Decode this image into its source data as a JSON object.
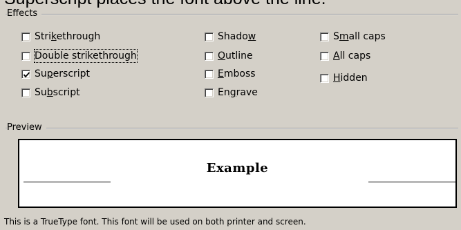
{
  "tooltip_caption": "Superscript places the font above the line.",
  "effects": {
    "group_title": "Effects",
    "options": [
      {
        "pre": "Stri",
        "key": "k",
        "post": "ethrough",
        "checked": false,
        "focused": false
      },
      {
        "pre": "Double strikethrough",
        "key": "",
        "post": "",
        "checked": false,
        "focused": true
      },
      {
        "pre": "Su",
        "key": "p",
        "post": "erscript",
        "checked": true,
        "focused": false
      },
      {
        "pre": "Su",
        "key": "b",
        "post": "script",
        "checked": false,
        "focused": false
      },
      {
        "pre": "Shado",
        "key": "w",
        "post": "",
        "checked": false,
        "focused": false
      },
      {
        "pre": "",
        "key": "O",
        "post": "utline",
        "checked": false,
        "focused": false
      },
      {
        "pre": "",
        "key": "E",
        "post": "mboss",
        "checked": false,
        "focused": false
      },
      {
        "pre": "En",
        "key": "g",
        "post": "rave",
        "checked": false,
        "focused": false
      },
      {
        "pre": "S",
        "key": "m",
        "post": "all caps",
        "checked": false,
        "focused": false
      },
      {
        "pre": "",
        "key": "A",
        "post": "ll caps",
        "checked": false,
        "focused": false
      },
      {
        "pre": "",
        "key": "H",
        "post": "idden",
        "checked": false,
        "focused": false
      }
    ]
  },
  "preview": {
    "group_title": "Preview",
    "sample_text": "Example"
  },
  "footer_text": "This is a TrueType font. This font will be used on both printer and screen."
}
